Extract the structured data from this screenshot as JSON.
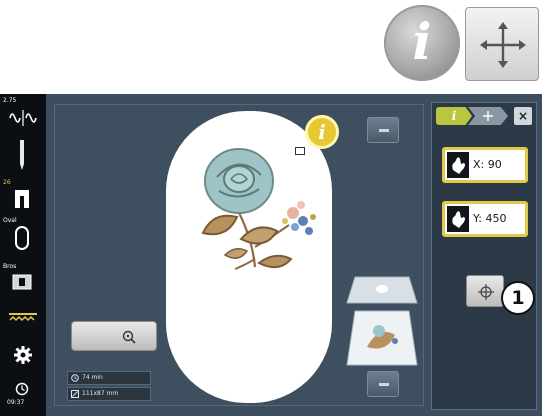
{
  "top": {
    "info_glyph": "i",
    "info_icon": "info-icon",
    "move_icon": "move-arrows-icon"
  },
  "sidebar": {
    "items": [
      {
        "label": "2.75",
        "icon": "stitch-width-icon"
      },
      {
        "label": "",
        "icon": "needle-icon"
      },
      {
        "label": "26",
        "icon": "presser-foot-icon"
      },
      {
        "label": "Oval",
        "icon": "hoop-oval-icon"
      },
      {
        "label": "Bros",
        "icon": "bobbin-icon"
      },
      {
        "label": "",
        "icon": "feed-dog-icon"
      },
      {
        "label": "",
        "icon": "settings-icon"
      },
      {
        "label": "09:37",
        "icon": "clock-icon"
      }
    ]
  },
  "canvas": {
    "small_info_glyph": "i",
    "stitch_time": "74 min",
    "design_size": "111x87 mm"
  },
  "panel": {
    "tab_info": "i",
    "x_value": "X: 90",
    "y_value": "Y: 450",
    "close_label": "×"
  },
  "callout": {
    "number": "1"
  },
  "colors": {
    "screen_bg": "#3d4f5f",
    "highlight": "#e0c84a",
    "rose_blue": "#9fc4c8",
    "leaf_brown": "#9a7a4e"
  }
}
